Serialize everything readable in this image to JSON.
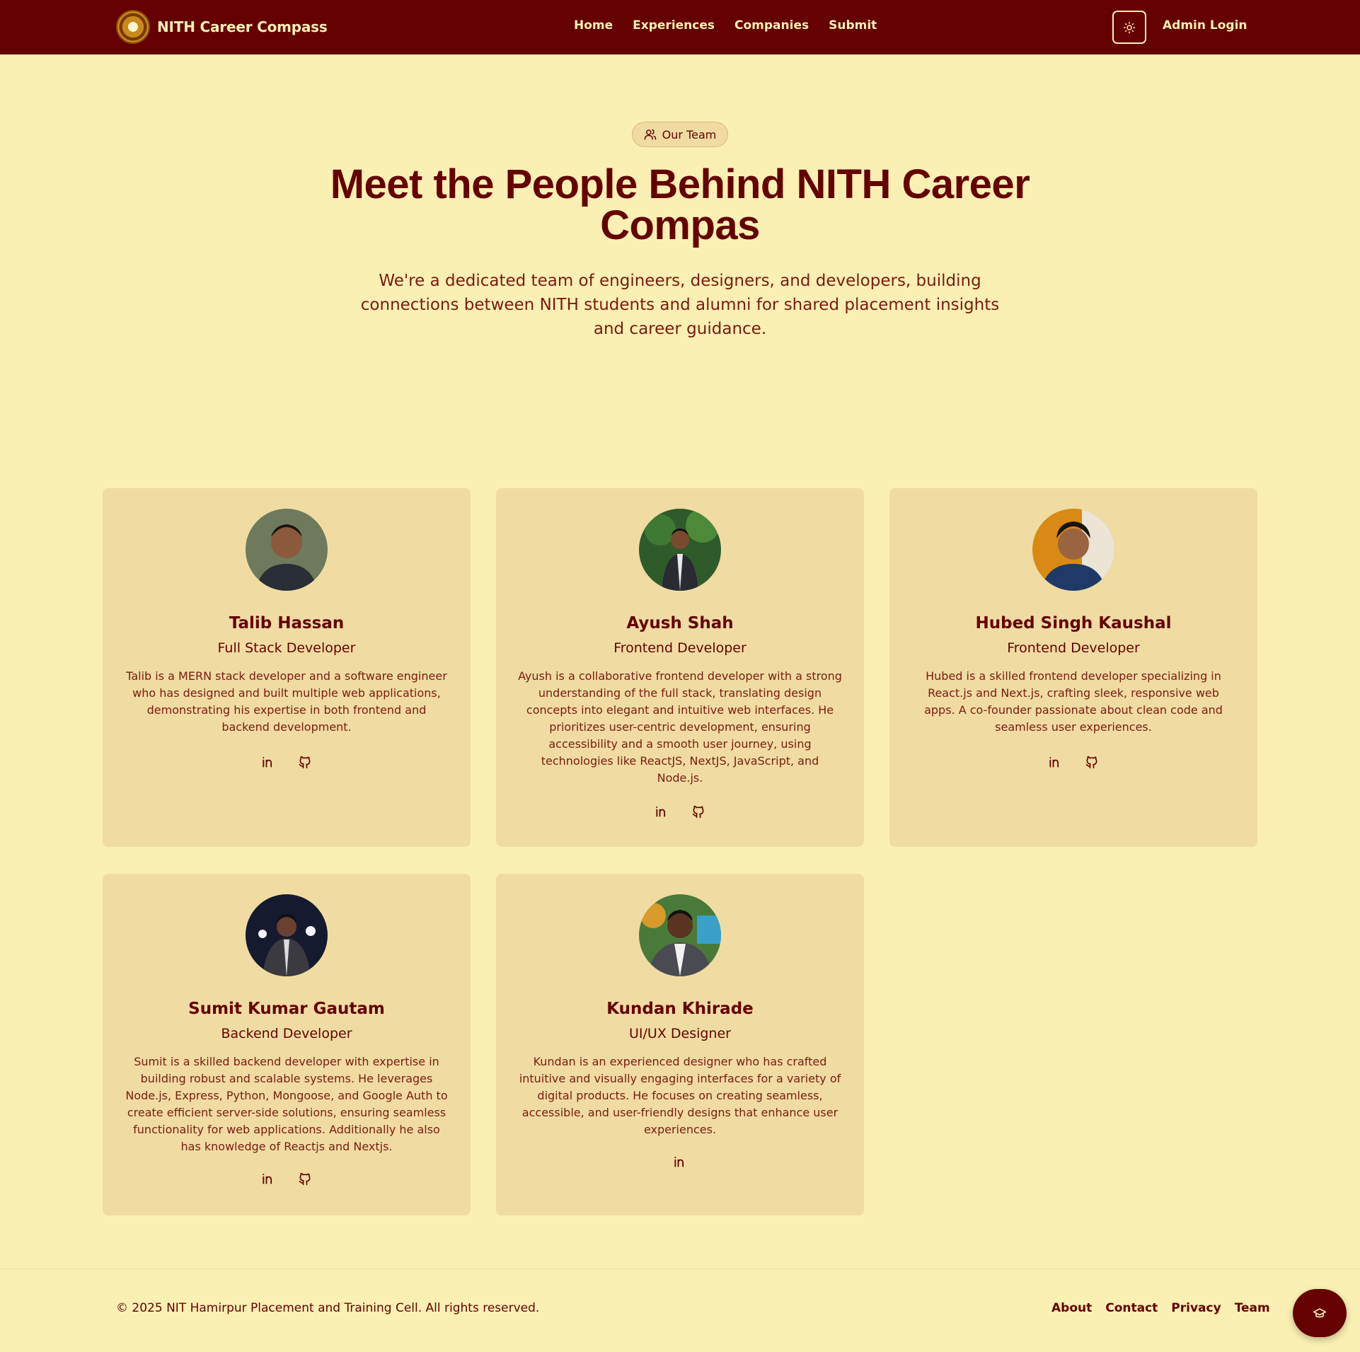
{
  "navbar": {
    "brand": "NITH Career Compass",
    "links": [
      "Home",
      "Experiences",
      "Companies",
      "Submit"
    ],
    "admin_login": "Admin Login",
    "theme_icon": "sun-icon"
  },
  "hero": {
    "badge": "Our Team",
    "title": "Meet the People Behind NITH Career Compas",
    "subtitle": "We're a dedicated team of engineers, designers, and developers, building connections between NITH students and alumni for shared placement insights and career guidance."
  },
  "team": [
    {
      "name": "Talib Hassan",
      "role": "Full Stack Developer",
      "bio": "Talib is a MERN stack developer and a software engineer who has designed and built multiple web applications, demonstrating his expertise in both frontend and backend development.",
      "socials": [
        "linkedin-icon",
        "github-icon"
      ]
    },
    {
      "name": "Ayush Shah",
      "role": "Frontend Developer",
      "bio": "Ayush is a collaborative frontend developer with a strong understanding of the full stack, translating design concepts into elegant and intuitive web interfaces. He prioritizes user-centric development, ensuring accessibility and a smooth user journey, using technologies like ReactJS, NextJS, JavaScript, and Node.js.",
      "socials": [
        "linkedin-icon",
        "github-icon"
      ]
    },
    {
      "name": "Hubed Singh Kaushal",
      "role": "Frontend Developer",
      "bio": "Hubed is a skilled frontend developer specializing in React.js and Next.js, crafting sleek, responsive web apps. A co-founder passionate about clean code and seamless user experiences.",
      "socials": [
        "linkedin-icon",
        "github-icon"
      ]
    },
    {
      "name": "Sumit Kumar Gautam",
      "role": "Backend Developer",
      "bio": "Sumit is a skilled backend developer with expertise in building robust and scalable systems. He leverages Node.js, Express, Python, Mongoose, and Google Auth to create efficient server-side solutions, ensuring seamless functionality for web applications. Additionally he also has knowledge of Reactjs and Nextjs.",
      "socials": [
        "linkedin-icon",
        "github-icon"
      ]
    },
    {
      "name": "Kundan Khirade",
      "role": "UI/UX Designer",
      "bio": "Kundan is an experienced designer who has crafted intuitive and visually engaging interfaces for a variety of digital products. He focuses on creating seamless, accessible, and user-friendly designs that enhance user experiences.",
      "socials": [
        "linkedin-icon"
      ]
    }
  ],
  "footer": {
    "copyright": "© 2025 NIT Hamirpur Placement and Training Cell. All rights reserved.",
    "links": [
      "About",
      "Contact",
      "Privacy",
      "Team"
    ],
    "fab_icon": "graduation-cap-icon"
  },
  "colors": {
    "primary": "#650000",
    "background": "#fbf0b3",
    "card": "#f0dca3"
  }
}
